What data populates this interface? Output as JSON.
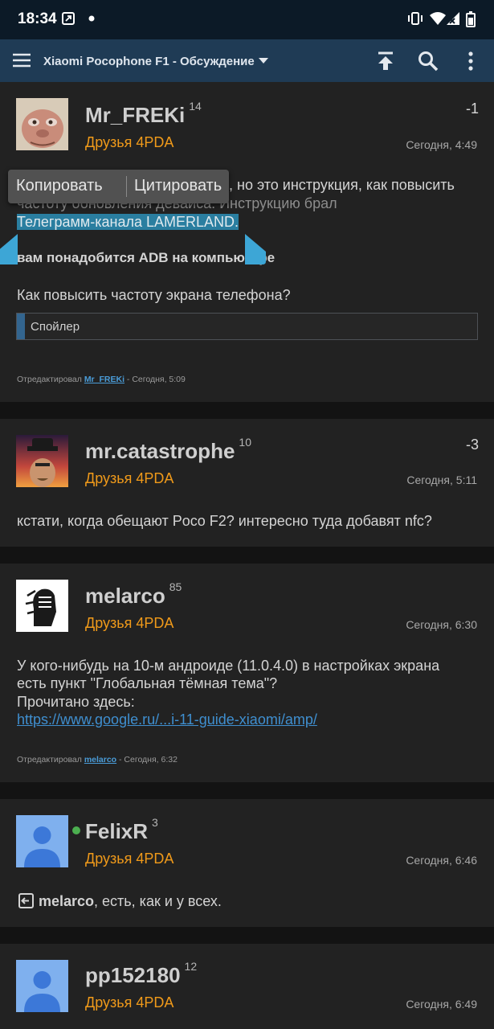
{
  "status_bar": {
    "time": "18:34"
  },
  "toolbar": {
    "title": "Xiaomi Pocophone F1 - Обсуждение"
  },
  "selection_popup": {
    "copy_label": "Копировать",
    "quote_label": "Цитировать"
  },
  "posts": [
    {
      "username": "Mr_FREKi",
      "rep": "14",
      "group": "Друзья 4PDA",
      "score": "-1",
      "date": "Сегодня, 4:49",
      "line1_visible": ", но это инструкция, как повысить",
      "line2_visible": "частоту обновления девайса. Инструкцию брал",
      "line3_selected": "Телеграмм-канала LAMERLAND.",
      "bold_line": "вам понадобится ADB на компьютере",
      "question": "Как повысить частоту экрана телефона?",
      "spoiler": "Спойлер",
      "edited_prefix": "Отредактировал",
      "edited_by": "Mr_FREKi",
      "edited_suffix": " - Сегодня, 5:09"
    },
    {
      "username": "mr.catastrophe",
      "rep": "10",
      "group": "Друзья 4PDA",
      "score": "-3",
      "date": "Сегодня, 5:11",
      "text": "кстати, когда обещают Poco F2? интересно туда добавят nfc?"
    },
    {
      "username": "melarco",
      "rep": "85",
      "group": "Друзья 4PDA",
      "date": "Сегодня, 6:30",
      "line1": "У кого-нибудь на 10-м андроиде (11.0.4.0) в настройках экрана",
      "line2": "есть пункт \"Глобальная тёмная тема\"?",
      "line3": "Прочитано здесь:",
      "link": "https://www.google.ru/...i-11-guide-xiaomi/amp/",
      "edited_prefix": "Отредактировал",
      "edited_by": "melarco",
      "edited_suffix": " - Сегодня, 6:32"
    },
    {
      "username": "FelixR",
      "rep": "3",
      "group": "Друзья 4PDA",
      "date": "Сегодня, 6:46",
      "reply_to": "melarco",
      "text": ", есть, как и у всех."
    },
    {
      "username": "pp152180",
      "rep": "12",
      "group": "Друзья 4PDA",
      "date": "Сегодня, 6:49"
    }
  ]
}
